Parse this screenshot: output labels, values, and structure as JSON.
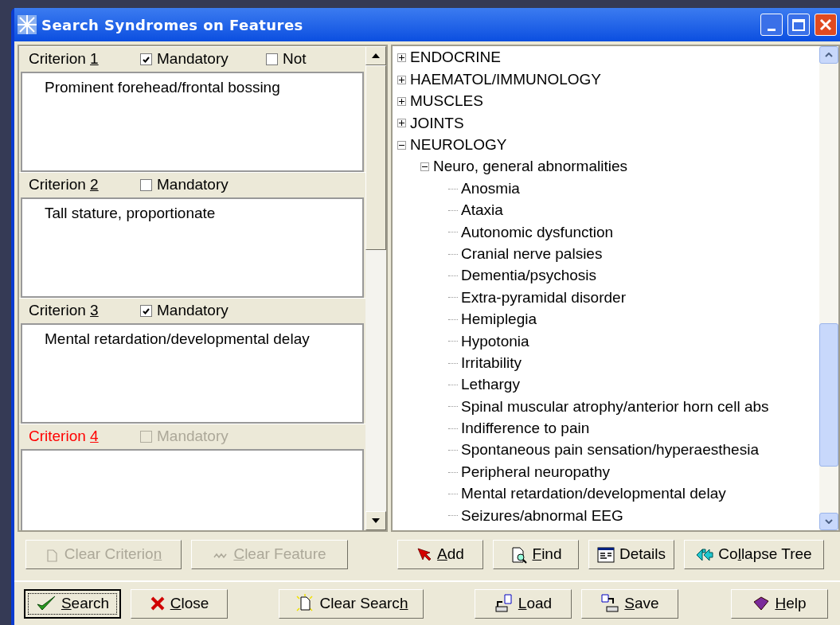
{
  "window": {
    "title": "Search Syndromes on Features"
  },
  "criteria": [
    {
      "label": {
        "pre": "Criterion ",
        "key": "1"
      },
      "current": false,
      "mandatory": {
        "label": "Mandatory",
        "checked": true,
        "disabled": false
      },
      "not": {
        "label": "Not",
        "checked": false
      },
      "feature": "Prominent forehead/frontal bossing"
    },
    {
      "label": {
        "pre": "Criterion ",
        "key": "2"
      },
      "current": false,
      "mandatory": {
        "label": "Mandatory",
        "checked": false,
        "disabled": false
      },
      "feature": "Tall stature, proportionate"
    },
    {
      "label": {
        "pre": "Criterion ",
        "key": "3"
      },
      "current": false,
      "mandatory": {
        "label": "Mandatory",
        "checked": true,
        "disabled": false
      },
      "feature": "Mental retardation/developmental delay"
    },
    {
      "label": {
        "pre": "Criterion ",
        "key": "4"
      },
      "current": true,
      "mandatory": {
        "label": "Mandatory",
        "checked": false,
        "disabled": true
      }
    }
  ],
  "criterion_buttons": [
    {
      "kind": "clear-criterion",
      "label": {
        "pre": "Clear Criterio",
        "key": "n"
      },
      "disabled": true
    },
    {
      "kind": "clear-feature",
      "label": {
        "key": "C",
        "post": "lear Feature"
      },
      "disabled": true
    }
  ],
  "tree": [
    {
      "label": "ENDOCRINE",
      "expanded": false
    },
    {
      "label": "HAEMATOL/IMMUNOLOGY",
      "expanded": false
    },
    {
      "label": "MUSCLES",
      "expanded": false
    },
    {
      "label": "JOINTS",
      "expanded": false
    },
    {
      "label": "NEUROLOGY",
      "expanded": true,
      "children": [
        {
          "label": "Neuro, general abnormalities",
          "expanded": true,
          "children": [
            {
              "label": "Anosmia"
            },
            {
              "label": "Ataxia"
            },
            {
              "label": "Autonomic dysfunction"
            },
            {
              "label": "Cranial nerve palsies"
            },
            {
              "label": "Dementia/psychosis"
            },
            {
              "label": "Extra-pyramidal disorder"
            },
            {
              "label": "Hemiplegia"
            },
            {
              "label": "Hypotonia"
            },
            {
              "label": "Irritability"
            },
            {
              "label": "Lethargy"
            },
            {
              "label": "Spinal muscular atrophy/anterior horn cell abs"
            },
            {
              "label": "Indifference to pain"
            },
            {
              "label": "Spontaneous pain sensation/hyperaesthesia"
            },
            {
              "label": "Peripheral neuropathy"
            },
            {
              "label": "Mental retardation/developmental delay"
            },
            {
              "label": "Seizures/abnormal EEG"
            }
          ]
        }
      ]
    }
  ],
  "tree_buttons": [
    {
      "kind": "add",
      "label": {
        "key": "A",
        "post": "dd"
      },
      "disabled": false
    },
    {
      "kind": "find",
      "label": {
        "key": "F",
        "post": "ind"
      },
      "disabled": false
    },
    {
      "kind": "details",
      "label": {
        "pre": "Details"
      },
      "disabled": false
    },
    {
      "kind": "collapse",
      "label": {
        "pre": "Co",
        "key": "l",
        "post": "lapse Tree"
      },
      "disabled": false
    }
  ],
  "footer_buttons": [
    {
      "kind": "search",
      "label": {
        "key": "S",
        "post": "earch"
      },
      "default": true
    },
    {
      "kind": "close",
      "label": {
        "key": "C",
        "post": "lose"
      },
      "default": false
    },
    {
      "kind": "clear-search",
      "label": {
        "pre": "Clear Searc",
        "key": "h"
      },
      "default": false
    },
    {
      "kind": "load",
      "label": {
        "key": "L",
        "post": "oad"
      },
      "default": false
    },
    {
      "kind": "save",
      "label": {
        "key": "S",
        "post": "ave"
      },
      "default": false
    },
    {
      "kind": "help",
      "label": {
        "key": "H",
        "post": "elp"
      },
      "default": false
    }
  ]
}
